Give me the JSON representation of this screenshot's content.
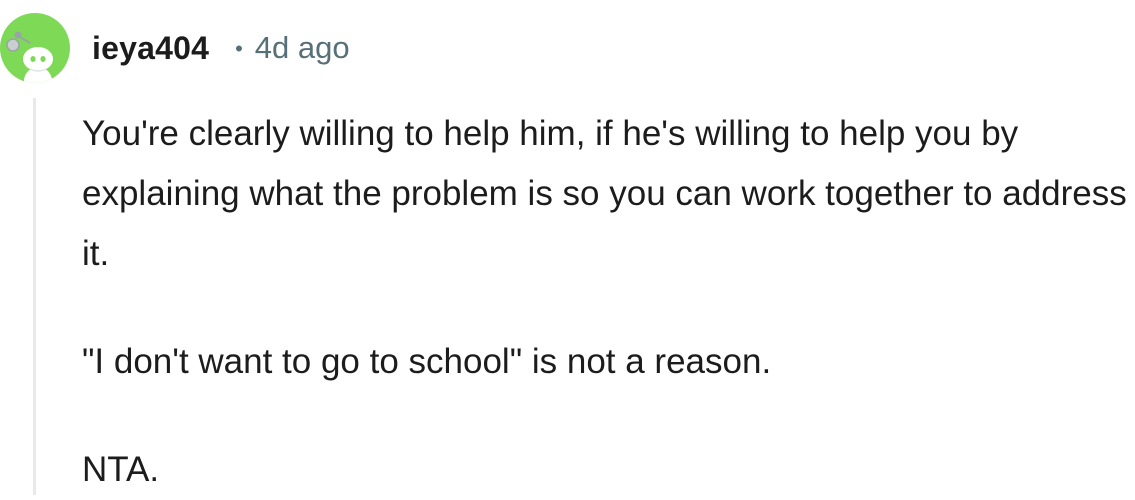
{
  "comment": {
    "avatar_icon": "snoo-avatar-icon",
    "avatar_color": "#7ed957",
    "username": "ieya404",
    "separator": "•",
    "timestamp": "4d ago",
    "paragraphs": [
      "You're clearly willing to help him, if he's willing to help you by explaining what the problem is so you can work together to address it.",
      "\"I don't want to go to school\" is not a reason.",
      "NTA."
    ]
  }
}
